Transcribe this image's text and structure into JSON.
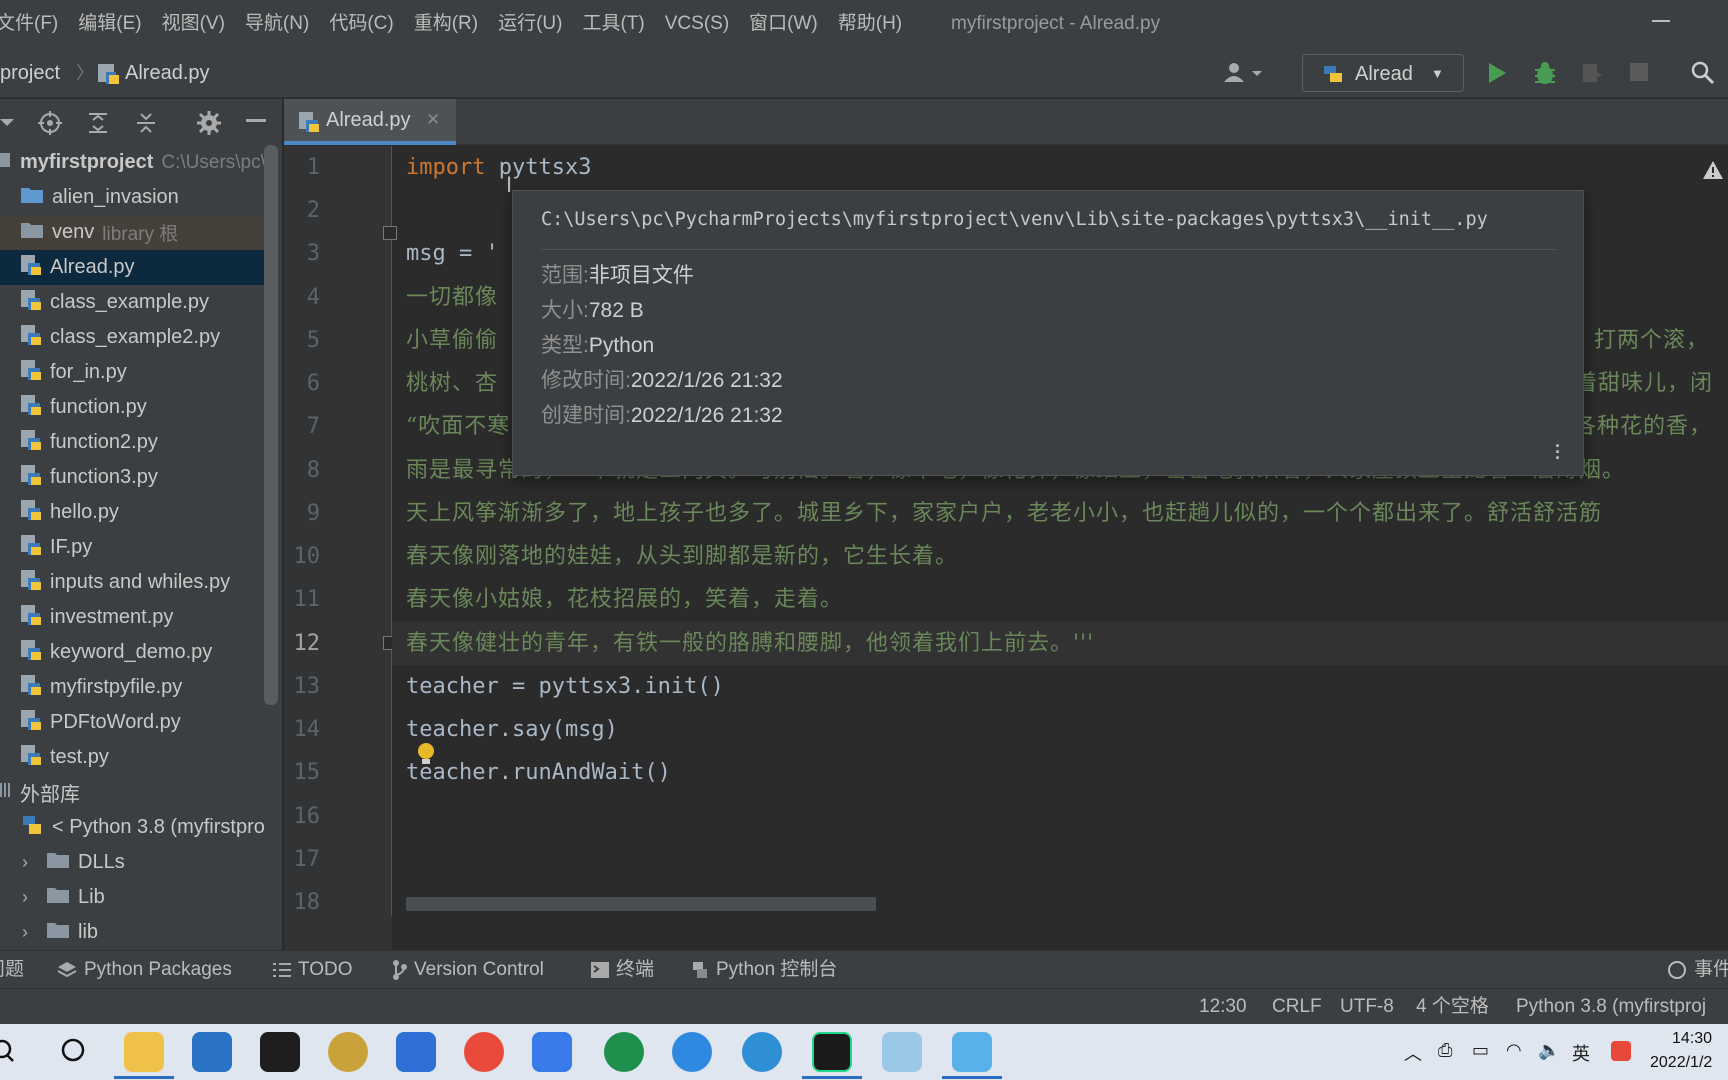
{
  "menu": {
    "items": [
      "文件(F)",
      "编辑(E)",
      "视图(V)",
      "导航(N)",
      "代码(C)",
      "重构(R)",
      "运行(U)",
      "工具(T)",
      "VCS(S)",
      "窗口(W)",
      "帮助(H)"
    ]
  },
  "window_title": "myfirstproject - Alread.py",
  "breadcrumb": {
    "project": "project",
    "file": "Alread.py"
  },
  "run_config": {
    "label": "Alread"
  },
  "editor_tab": {
    "label": "Alread.py"
  },
  "project_tree": {
    "root": {
      "label": "myfirstproject",
      "path_hint": "C:\\Users\\pc\\"
    },
    "items": [
      {
        "label": "alien_invasion",
        "hint": "",
        "type": "folder"
      },
      {
        "label": "venv",
        "hint": "library 根",
        "type": "folder"
      },
      {
        "label": "Alread.py",
        "hint": "",
        "type": "python",
        "selected": true
      },
      {
        "label": "class_example.py",
        "hint": "",
        "type": "python"
      },
      {
        "label": "class_example2.py",
        "hint": "",
        "type": "python"
      },
      {
        "label": "for_in.py",
        "hint": "",
        "type": "python"
      },
      {
        "label": "function.py",
        "hint": "",
        "type": "python"
      },
      {
        "label": "function2.py",
        "hint": "",
        "type": "python"
      },
      {
        "label": "function3.py",
        "hint": "",
        "type": "python"
      },
      {
        "label": "hello.py",
        "hint": "",
        "type": "python"
      },
      {
        "label": "IF.py",
        "hint": "",
        "type": "python"
      },
      {
        "label": "inputs and whiles.py",
        "hint": "",
        "type": "python"
      },
      {
        "label": "investment.py",
        "hint": "",
        "type": "python"
      },
      {
        "label": "keyword_demo.py",
        "hint": "",
        "type": "python"
      },
      {
        "label": "myfirstpyfile.py",
        "hint": "",
        "type": "python"
      },
      {
        "label": "PDFtoWord.py",
        "hint": "",
        "type": "python"
      },
      {
        "label": "test.py",
        "hint": "",
        "type": "python"
      }
    ],
    "external_libs": {
      "label": "外部库"
    },
    "python_sdk": {
      "label": "< Python 3.8 (myfirstpro"
    },
    "sdk_children": [
      {
        "label": "DLLs"
      },
      {
        "label": "Lib"
      },
      {
        "label": "lib"
      }
    ]
  },
  "editor": {
    "line_numbers": [
      "1",
      "2",
      "3",
      "4",
      "5",
      "6",
      "7",
      "8",
      "9",
      "10",
      "11",
      "12",
      "13",
      "14",
      "15",
      "16",
      "17",
      "18"
    ],
    "current_line": "12",
    "code": {
      "l1_kw": "import",
      "l1_rest": " pyttsx3",
      "l3_a": "msg = '",
      "l4": "一切都像",
      "l5_a": "小草偷偷",
      "l5_b": "打两个滚，",
      "l6_a": "桃树、杏",
      "l6_b": "带着甜味儿，闭",
      "l7_a": "“吹面不寒",
      "l7_b": "各种花的香，",
      "l8": "雨是最寻常的，一下就是三两天。可别恼。看，像牛毛，像花针，像细丝，密密地斜织着，人家屋顶上全笼着一层薄烟。",
      "l9": "天上风筝渐渐多了，地上孩子也多了。城里乡下，家家户户，老老小小，也赶趟儿似的，一个个都出来了。舒活舒活筋",
      "l10": "春天像刚落地的娃娃，从头到脚都是新的，它生长着。",
      "l11": "春天像小姑娘，花枝招展的，笑着，走着。",
      "l12": "春天像健壮的青年，有铁一般的胳膊和腰脚，他领着我们上前去。'''",
      "l13": "teacher = pyttsx3.init()",
      "l14": "teacher.say(msg)",
      "l15": "teacher.runAndWait()"
    }
  },
  "doc_popup": {
    "path": "C:\\Users\\pc\\PycharmProjects\\myfirstproject\\venv\\Lib\\site-packages\\pyttsx3\\__init__.py",
    "rows": [
      {
        "key": "范围:",
        "value": "非项目文件"
      },
      {
        "key": "大小:",
        "value": "782 B"
      },
      {
        "key": "类型:",
        "value": "Python"
      },
      {
        "key": "修改时间:",
        "value": "2022/1/26 21:32"
      },
      {
        "key": "创建时间:",
        "value": "2022/1/26 21:32"
      }
    ]
  },
  "tool_windows": {
    "problems": "问题",
    "python_packages": "Python Packages",
    "todo": "TODO",
    "version_control": "Version Control",
    "terminal": "终端",
    "python_console": "Python 控制台",
    "event_log": "事件"
  },
  "status": {
    "position": "12:30",
    "line_sep": "CRLF",
    "encoding": "UTF-8",
    "indent": "4 个空格",
    "interpreter": "Python 3.8 (myfirstproj"
  },
  "taskbar": {
    "ime": "英",
    "time": "14:30",
    "date": "2022/1/2"
  },
  "colors": {
    "keyword": "#cc7832",
    "string": "#6a8759",
    "identifier": "#a9b7c6",
    "selection": "#0d293e",
    "run_green": "#499c54"
  }
}
